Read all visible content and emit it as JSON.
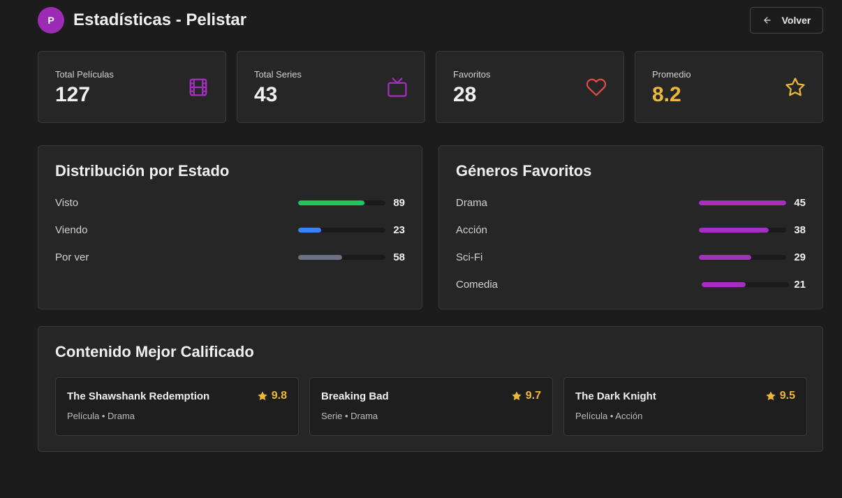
{
  "header": {
    "logo_letter": "P",
    "title": "Estadísticas - Pelistar",
    "back_label": "Volver"
  },
  "stats": [
    {
      "label": "Total Películas",
      "value": "127",
      "icon": "film-icon",
      "color": "#a52fc1"
    },
    {
      "label": "Total Series",
      "value": "43",
      "icon": "tv-icon",
      "color": "#a52fc1"
    },
    {
      "label": "Favoritos",
      "value": "28",
      "icon": "heart-icon",
      "color": "#e84a4a"
    },
    {
      "label": "Promedio",
      "value": "8.2",
      "icon": "star-icon",
      "color": "#ecb83b"
    }
  ],
  "status_panel": {
    "title": "Distribución por Estado",
    "rows": [
      {
        "label": "Visto",
        "value": 89,
        "fraction": 0.76,
        "color": "#22c55e"
      },
      {
        "label": "Viendo",
        "value": 23,
        "fraction": 0.26,
        "color": "#3b82f6"
      },
      {
        "label": "Por ver",
        "value": 58,
        "fraction": 0.5,
        "color": "#6b7280"
      }
    ]
  },
  "genres_panel": {
    "title": "Géneros Favoritos",
    "rows": [
      {
        "label": "Drama",
        "value": 45,
        "fraction": 1.0,
        "color": "#a52fc1"
      },
      {
        "label": "Acción",
        "value": 38,
        "fraction": 0.8,
        "color": "#a52fc1"
      },
      {
        "label": "Sci-Fi",
        "value": 29,
        "fraction": 0.6,
        "color": "#a52fc1"
      },
      {
        "label": "Comedia",
        "value": 21,
        "fraction": 0.5,
        "color": "#a52fc1"
      }
    ]
  },
  "top_rated": {
    "title": "Contenido Mejor Calificado",
    "items": [
      {
        "title": "The Shawshank Redemption",
        "rating": "9.8",
        "meta": "Película • Drama"
      },
      {
        "title": "Breaking Bad",
        "rating": "9.7",
        "meta": "Serie • Drama"
      },
      {
        "title": "The Dark Knight",
        "rating": "9.5",
        "meta": "Película • Acción"
      }
    ]
  }
}
